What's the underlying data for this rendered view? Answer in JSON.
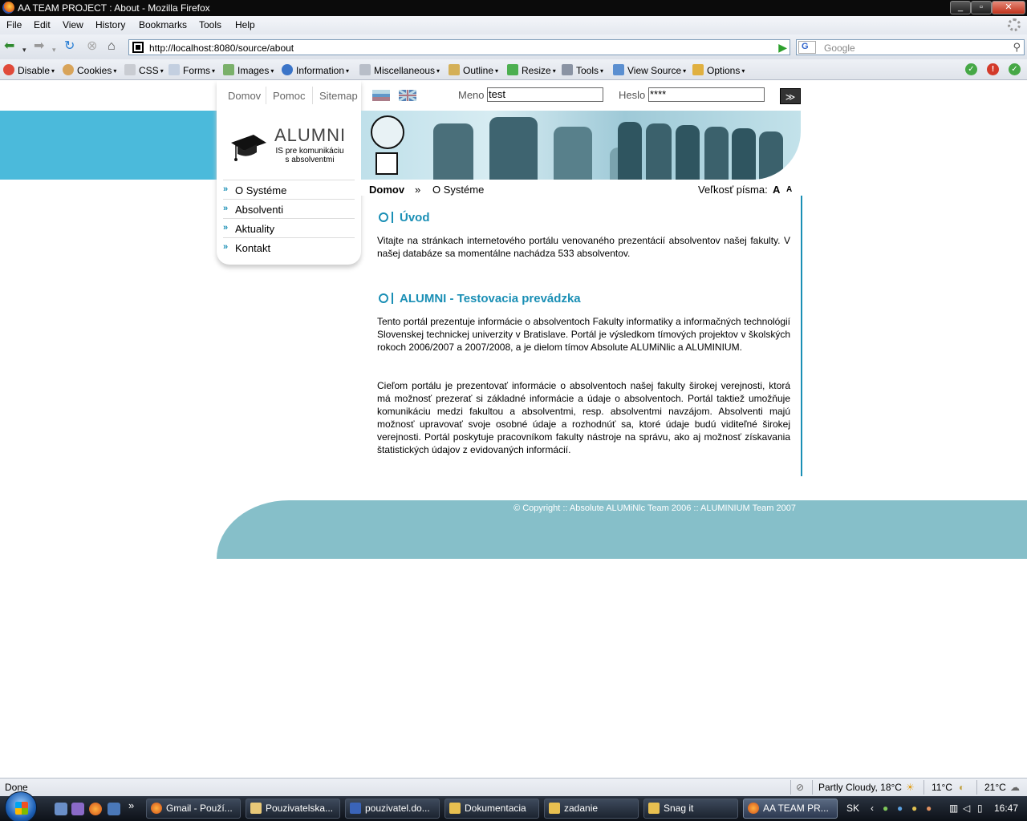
{
  "window": {
    "title": "AA TEAM PROJECT : About - Mozilla Firefox",
    "buttons": [
      "_",
      "▫",
      "✕"
    ]
  },
  "menubar": {
    "items": [
      "File",
      "Edit",
      "View",
      "History",
      "Bookmarks",
      "Tools",
      "Help"
    ]
  },
  "navbar": {
    "url": "http://localhost:8080/source/about",
    "search_placeholder": "Google",
    "search_engine": "G"
  },
  "devtoolbar": {
    "items": [
      "Disable",
      "Cookies",
      "CSS",
      "Forms",
      "Images",
      "Information",
      "Miscellaneous",
      "Outline",
      "Resize",
      "Tools",
      "View Source",
      "Options"
    ]
  },
  "site": {
    "toplinks": [
      "Domov",
      "Pomoc",
      "Sitemap"
    ],
    "login": {
      "name_label": "Meno",
      "name_value": "test",
      "pass_label": "Heslo",
      "pass_value": "****",
      "submit": "≫"
    },
    "logo": {
      "title": "ALUMNI",
      "subtitle_line1": "IS pre komunikáciu",
      "subtitle_line2": "s absolventmi"
    },
    "menu": [
      "O Systéme",
      "Absolventi",
      "Aktuality",
      "Kontakt"
    ],
    "breadcrumb": {
      "home": "Domov",
      "sep": "»",
      "current": "O Systéme",
      "font_label": "Veľkosť písma:",
      "font_a1": "A",
      "font_a2": "A"
    },
    "sections": [
      {
        "title": "Úvod",
        "paragraphs": [
          "Vitajte na stránkach internetového portálu venovaného prezentácií absolventov našej fakulty. V našej databáze sa momentálne nachádza 533 absolventov."
        ]
      },
      {
        "title": "ALUMNI - Testovacia prevádzka",
        "paragraphs": [
          "Tento portál prezentuje informácie o absolventoch Fakulty informatiky a informačných technológií Slovenskej technickej univerzity v Bratislave. Portál je výsledkom tímových projektov v školských rokoch 2006/2007 a 2007/2008, a je dielom tímov Absolute ALUMiNlic a ALUMINIUM.",
          "Cieľom portálu je prezentovať informácie o absolventoch našej fakulty širokej verejnosti, ktorá má možnosť prezerať si základné informácie a údaje o absolventoch. Portál taktiež umožňuje komunikáciu medzi fakultou a absolventmi, resp. absolventmi navzájom. Absolventi majú možnosť upravovať svoje osobné údaje a rozhodnúť sa, ktoré údaje budú viditeľné širokej verejnosti. Portál poskytuje pracovníkom fakulty nástroje na správu, ako aj možnosť získavania štatistických údajov z evidovaných informácií."
        ]
      }
    ],
    "footer": "© Copyright :: Absolute ALUMiNlc Team 2006 :: ALUMINIUM Team 2007"
  },
  "statusbar": {
    "status": "Done",
    "weather1": "Partly Cloudy, 18°C",
    "weather2": "11°C",
    "weather3": "21°C"
  },
  "taskbar": {
    "tasks": [
      "Gmail - Použí...",
      "Pouzivatelska...",
      "pouzivatel.do...",
      "Dokumentacia",
      "zadanie",
      "Snag it",
      "AA TEAM PR..."
    ],
    "lang": "SK",
    "clock": "16:47"
  },
  "colors": {
    "accent": "#1a8fb5",
    "strip": "#4bbadb",
    "footer": "#86bfc9"
  }
}
